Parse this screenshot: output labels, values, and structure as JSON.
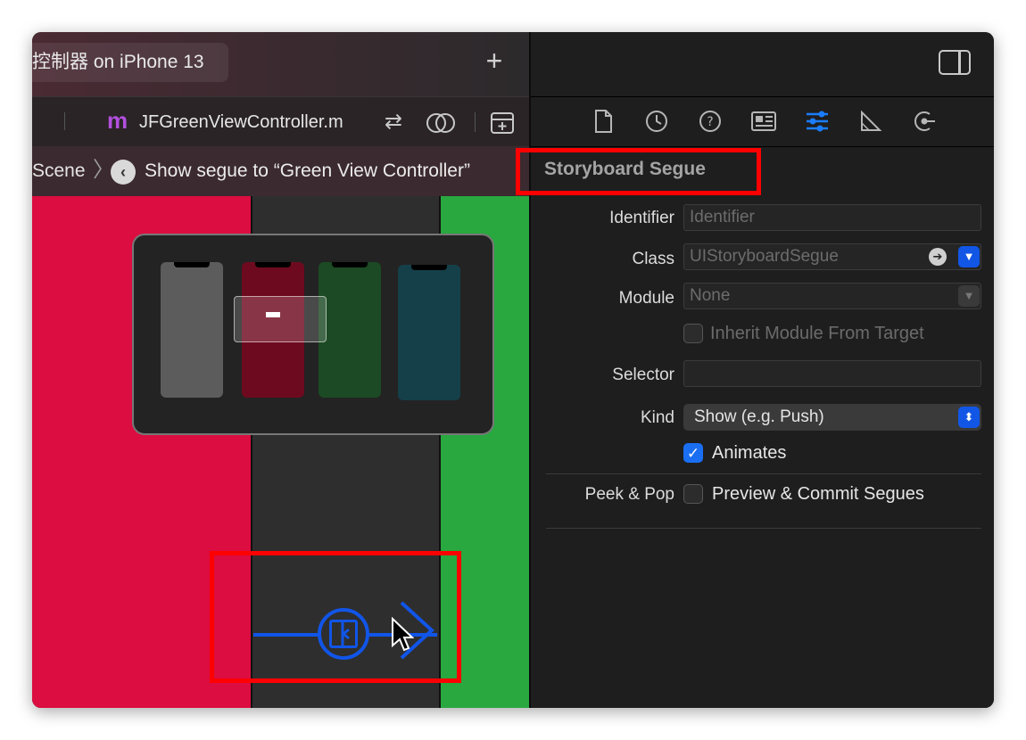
{
  "title_bar": {
    "scheme_title": "控制器 on iPhone 13",
    "add_label": "+"
  },
  "editor_tab": {
    "file_prefix": "m",
    "file_name": "JFGreenViewController.m"
  },
  "breadcrumb": {
    "scene": "Scene",
    "separator": "〉",
    "back_glyph": "‹",
    "segue": "Show segue to “Green View Controller”"
  },
  "inspector": {
    "section_title": "Storyboard Segue",
    "identifier_label": "Identifier",
    "identifier_placeholder": "Identifier",
    "class_label": "Class",
    "class_value": "UIStoryboardSegue",
    "module_label": "Module",
    "module_value": "None",
    "inherit_label": "Inherit Module From Target",
    "selector_label": "Selector",
    "selector_value": "",
    "kind_label": "Kind",
    "kind_value": "Show (e.g. Push)",
    "animates_label": "Animates",
    "animates_checked": true,
    "peek_label": "Peek & Pop",
    "peek_option": "Preview & Commit Segues",
    "peek_checked": false
  },
  "colors": {
    "red_controller": "#dc0d40",
    "green_controller": "#28a83f",
    "segue_blue": "#1155e8",
    "highlight_red": "#ff0000"
  },
  "minimap_phones": [
    {
      "name": "gray-controller",
      "color": "#5c5c5c"
    },
    {
      "name": "red-controller",
      "color": "#6e0a1f"
    },
    {
      "name": "green-controller",
      "color": "#1c4a24"
    },
    {
      "name": "teal-controller",
      "color": "#15404a"
    }
  ]
}
